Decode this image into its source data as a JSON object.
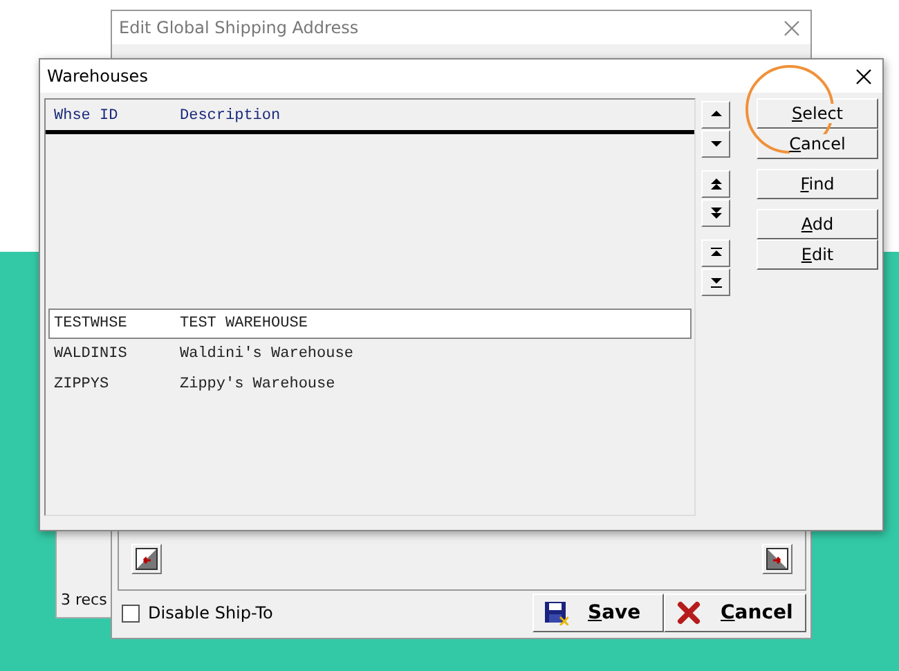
{
  "back_window": {
    "status": "3 recs"
  },
  "shipping_window": {
    "title": "Edit Global Shipping Address",
    "disable_ship_to": {
      "label": "Disable Ship-To",
      "checked": false
    },
    "buttons": [
      {
        "label": "Save",
        "kind": "save",
        "mnemonic": true
      },
      {
        "label": "Cancel",
        "kind": "cancel",
        "mnemonic": true
      }
    ]
  },
  "warehouses": {
    "title": "Warehouses",
    "columns": [
      "Whse ID",
      "Description"
    ],
    "rows": [
      {
        "id": "TESTWHSE",
        "description": "TEST WAREHOUSE",
        "selected": true
      },
      {
        "id": "WALDINIS",
        "description": "Waldini's Warehouse",
        "selected": false
      },
      {
        "id": "ZIPPYS",
        "description": "Zippy's Warehouse",
        "selected": false
      }
    ],
    "button_groups": [
      [
        {
          "label": "Select",
          "mnemonic": true
        },
        {
          "label": "Cancel",
          "mnemonic": true
        }
      ],
      [
        {
          "label": "Find",
          "mnemonic": true
        }
      ],
      [
        {
          "label": "Add",
          "mnemonic": true
        },
        {
          "label": "Edit",
          "mnemonic": true
        }
      ]
    ]
  }
}
